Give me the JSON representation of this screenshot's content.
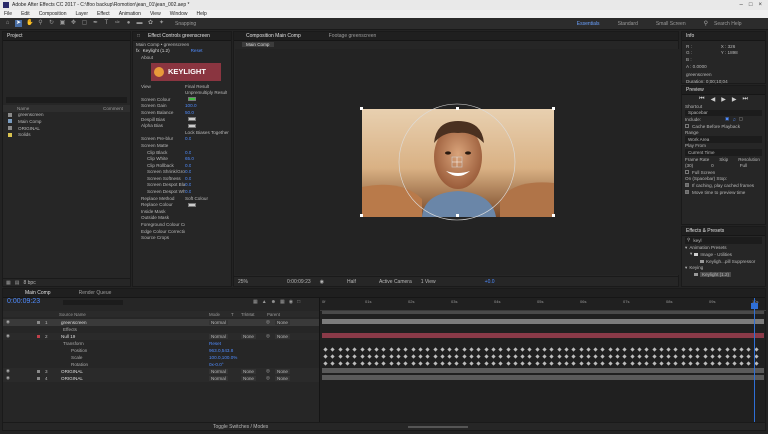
{
  "window": {
    "title": "Adobe After Effects CC 2017 - C:\\ffoo backup\\Romotion\\jean_01\\jean_002.aep *"
  },
  "menu": [
    "File",
    "Edit",
    "Composition",
    "Layer",
    "Effect",
    "Animation",
    "View",
    "Window",
    "Help"
  ],
  "toolbar": {
    "snapping": "Snapping",
    "workspaces": [
      "Essentials",
      "Standard",
      "Small Screen"
    ],
    "search_placeholder": "Search Help"
  },
  "project": {
    "tab": "Project",
    "col_name": "Name",
    "col_comment": "Comment",
    "items": [
      "greenscreen",
      "Main Comp",
      "ORIGINAL",
      "Solids"
    ],
    "footer": "8 bpc"
  },
  "effect_controls": {
    "tab": "Effect Controls greenscreen",
    "header": "Main Comp • greenscreen",
    "effect_name": "Keylight (1.2)",
    "reset": "Reset",
    "about": "About",
    "logo": "KEYLIGHT",
    "props": [
      {
        "label": "View",
        "value": "Final Result"
      },
      {
        "label": "",
        "value": "Unpremultiply Result"
      },
      {
        "label": "Screen Colour",
        "value": ""
      },
      {
        "label": "Screen Gain",
        "value": "100.0"
      },
      {
        "label": "Screen Balance",
        "value": "50.0"
      },
      {
        "label": "Despill Bias",
        "value": ""
      },
      {
        "label": "Alpha Bias",
        "value": ""
      },
      {
        "label": "",
        "value": "Lock Biases Together"
      },
      {
        "label": "Screen Pre-blur",
        "value": "0.0"
      },
      {
        "label": "Screen Matte",
        "value": ""
      },
      {
        "label": "Clip Black",
        "value": "0.0"
      },
      {
        "label": "Clip White",
        "value": "65.0"
      },
      {
        "label": "Clip Rollback",
        "value": "0.0"
      },
      {
        "label": "Screen Shrink/Grow",
        "value": "0.0"
      },
      {
        "label": "Screen Softness",
        "value": "0.0"
      },
      {
        "label": "Screen Despot Black",
        "value": "0.0"
      },
      {
        "label": "Screen Despot White",
        "value": "0.0"
      },
      {
        "label": "Replace Method",
        "value": "Soft Colour"
      },
      {
        "label": "Replace Colour",
        "value": ""
      },
      {
        "label": "Inside Mask",
        "value": ""
      },
      {
        "label": "Outside Mask",
        "value": ""
      },
      {
        "label": "Foreground Colour Correction",
        "value": ""
      },
      {
        "label": "Edge Colour Correction",
        "value": ""
      },
      {
        "label": "Source Crops",
        "value": ""
      }
    ]
  },
  "composition": {
    "tab": "Composition Main Comp",
    "footage_tab": "Footage greenscreen",
    "comp_label": "Main Comp",
    "footer": {
      "zoom": "25%",
      "timecode": "0:00:09:23",
      "resolution": "Half",
      "camera": "Active Camera",
      "views": "1 View",
      "offset": "+0.0"
    }
  },
  "info": {
    "tab": "Info",
    "r": "R :",
    "g": "G :",
    "b": "B :",
    "a": "A : 0.0000",
    "x": "X : 326",
    "y": "Y : 1898",
    "comp_name": "greenscreen",
    "duration": "Duration: 0;00;10;04"
  },
  "preview": {
    "tab": "Preview",
    "shortcut_label": "Shortcut",
    "shortcut": "Spacebar",
    "include_label": "Include:",
    "cache": "Cache Before Playback",
    "range_label": "Range",
    "range": "Work Area",
    "playfrom_label": "Play From",
    "playfrom": "Current Time",
    "framerate_label": "Frame Rate",
    "skip_label": "Skip",
    "res_label": "Resolution",
    "framerate": "(30)",
    "skip": "0",
    "res": "Full",
    "fullscreen": "Full Screen",
    "stop_label": "On (Spacebar) Stop:",
    "if_caching": "If caching, play cached frames",
    "move_time": "Move time to preview time"
  },
  "effects_presets": {
    "tab": "Effects & Presets",
    "search": "keyl",
    "tree": [
      "Animation Presets",
      "Image - Utilities",
      "Keyligh...pill Suppressor",
      "Keying",
      "Keylight (1.2)"
    ]
  },
  "timeline": {
    "tabs": [
      "Main Comp",
      "Render Queue"
    ],
    "timecode": "0:00:09:23",
    "columns": {
      "source": "Source Name",
      "mode": "Mode",
      "t": "T",
      "trkmat": "TrkMat",
      "parent": "Parent"
    },
    "layers": [
      {
        "num": "1",
        "name": "greenscreen",
        "mode": "Normal",
        "trkmat": "",
        "parent": "None"
      },
      {
        "num": "",
        "name": "Effects",
        "mode": "",
        "trkmat": "",
        "parent": ""
      },
      {
        "num": "2",
        "name": "Null 19",
        "mode": "Normal",
        "trkmat": "None",
        "parent": "None"
      },
      {
        "num": "",
        "name": "Transform",
        "mode": "Reset",
        "trkmat": "",
        "parent": ""
      },
      {
        "num": "",
        "name": "Position",
        "mode": "963.0,543.8",
        "trkmat": "",
        "parent": ""
      },
      {
        "num": "",
        "name": "Scale",
        "mode": "100.0,100.0%",
        "trkmat": "",
        "parent": ""
      },
      {
        "num": "",
        "name": "Rotation",
        "mode": "0x-0.0°",
        "trkmat": "",
        "parent": ""
      },
      {
        "num": "3",
        "name": "ORIGINAL",
        "mode": "Normal",
        "trkmat": "None",
        "parent": "None"
      },
      {
        "num": "4",
        "name": "ORIGINAL",
        "mode": "Normal",
        "trkmat": "None",
        "parent": "None"
      }
    ],
    "ruler": [
      "0f",
      "01s",
      "02s",
      "03s",
      "04s",
      "05s",
      "06s",
      "07s",
      "08s",
      "09s",
      "10s"
    ],
    "toggle": "Toggle Switches / Modes",
    "colors": {
      "label_red": "#c0404a",
      "label_grey": "#8a8a8a",
      "playhead": "#2f6fd6"
    }
  }
}
